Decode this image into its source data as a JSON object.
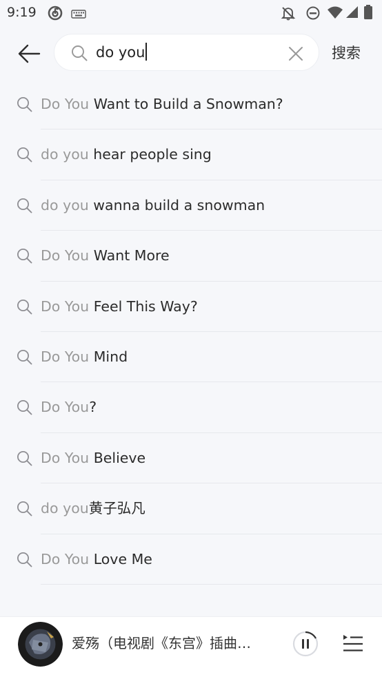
{
  "status_bar": {
    "time": "9:19",
    "icons": [
      "netease-music-icon",
      "keyboard-icon",
      "mute-icon",
      "do-not-disturb-icon",
      "wifi-icon",
      "signal-icon",
      "battery-icon"
    ]
  },
  "search": {
    "query": "do you",
    "action_label": "搜索"
  },
  "suggestions": [
    {
      "prefix": "Do You",
      "rest": " Want to Build a Snowman?"
    },
    {
      "prefix": "do you",
      "rest": " hear people sing"
    },
    {
      "prefix": "do you",
      "rest": " wanna build a snowman"
    },
    {
      "prefix": "Do You",
      "rest": " Want More"
    },
    {
      "prefix": "Do You",
      "rest": " Feel This Way?"
    },
    {
      "prefix": "Do You",
      "rest": " Mind"
    },
    {
      "prefix": "Do You",
      "rest": "?"
    },
    {
      "prefix": "Do You",
      "rest": " Believe"
    },
    {
      "prefix": "do you",
      "rest": "黄子弘凡"
    },
    {
      "prefix": "Do You",
      "rest": " Love Me"
    }
  ],
  "player": {
    "song_title": "爱殇（电视剧《东宫》插曲…"
  },
  "colors": {
    "background": "#f6f7fa",
    "query_highlight": "#999999",
    "text": "#2b2b2b"
  }
}
